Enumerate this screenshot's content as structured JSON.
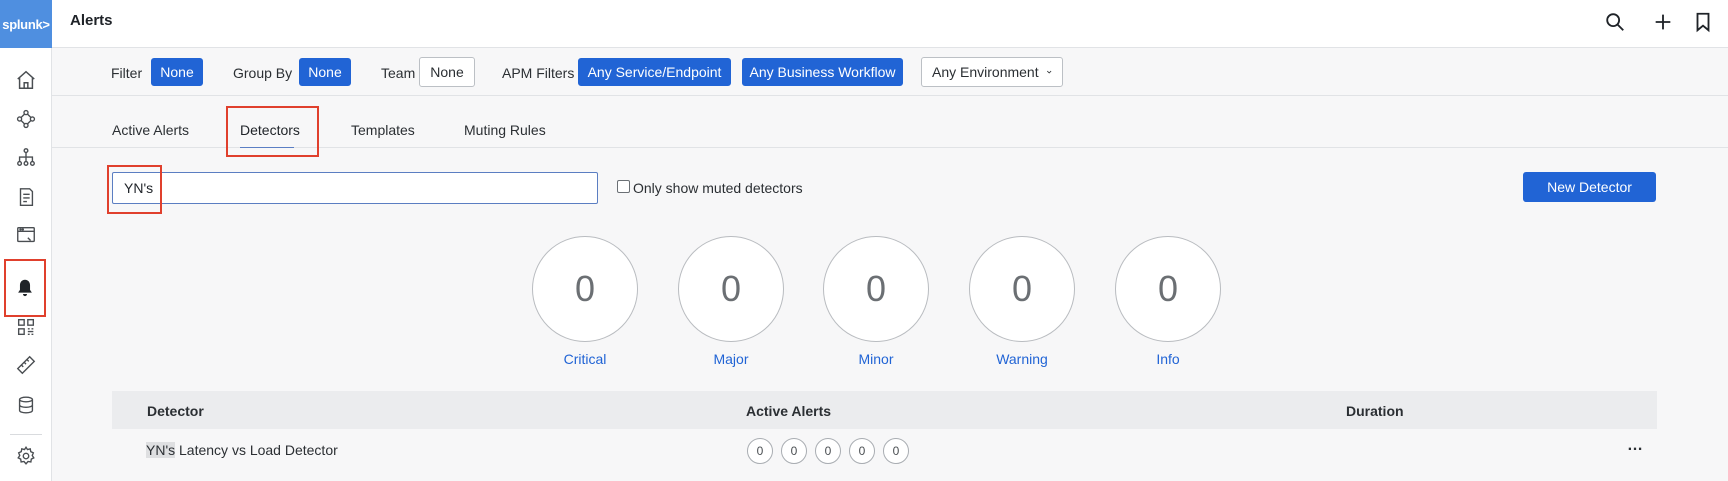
{
  "brand": {
    "logo_text": "splunk>",
    "accent": "#2164d5",
    "highlight": "#e0402d"
  },
  "header": {
    "title": "Alerts",
    "icons": [
      "search-icon",
      "plus-icon",
      "bookmark-icon"
    ]
  },
  "rail": {
    "items": [
      "home-icon",
      "topology-icon",
      "hierarchy-icon",
      "document-icon",
      "browser-icon",
      "bell-icon",
      "dashboard-grid-icon",
      "ruler-icon",
      "database-icon",
      "gear-icon"
    ],
    "active": "bell-icon"
  },
  "filters": {
    "filter_label": "Filter",
    "filter_value": "None",
    "groupby_label": "Group By",
    "groupby_value": "None",
    "team_label": "Team",
    "team_value": "None",
    "apm_label": "APM Filters",
    "service_btn": "Any Service/Endpoint",
    "workflow_btn": "Any Business Workflow",
    "environment_btn": "Any Environment"
  },
  "tabs": [
    {
      "label": "Active Alerts"
    },
    {
      "label": "Detectors",
      "active": true
    },
    {
      "label": "Templates"
    },
    {
      "label": "Muting Rules"
    }
  ],
  "search": {
    "value": "YN's",
    "muted_label": "Only show muted detectors",
    "muted_checked": false
  },
  "new_detector": "New Detector",
  "severity": [
    {
      "count": "0",
      "label": "Critical"
    },
    {
      "count": "0",
      "label": "Major"
    },
    {
      "count": "0",
      "label": "Minor"
    },
    {
      "count": "0",
      "label": "Warning"
    },
    {
      "count": "0",
      "label": "Info"
    }
  ],
  "table": {
    "columns": [
      "Detector",
      "Active Alerts",
      "Duration"
    ],
    "rows": [
      {
        "name_match": "YN's",
        "name_rest": " Latency vs Load Detector",
        "alerts": [
          "0",
          "0",
          "0",
          "0",
          "0"
        ],
        "more": "…"
      }
    ]
  }
}
